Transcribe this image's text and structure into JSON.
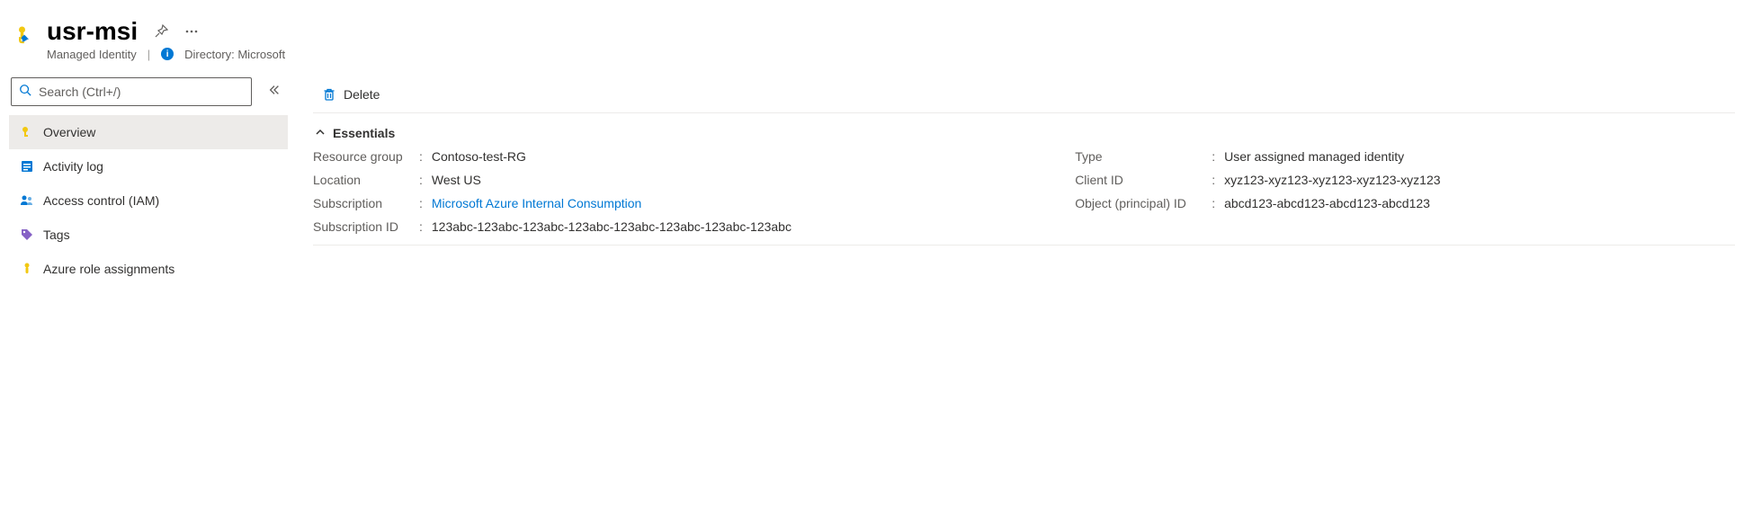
{
  "header": {
    "title": "usr-msi",
    "subtitle_type": "Managed Identity",
    "directory_label": "Directory: Microsoft"
  },
  "search": {
    "placeholder": "Search (Ctrl+/)"
  },
  "nav": {
    "items": [
      {
        "label": "Overview"
      },
      {
        "label": "Activity log"
      },
      {
        "label": "Access control (IAM)"
      },
      {
        "label": "Tags"
      },
      {
        "label": "Azure role assignments"
      }
    ]
  },
  "toolbar": {
    "delete_label": "Delete"
  },
  "essentials": {
    "title": "Essentials",
    "left": {
      "resource_group_label": "Resource group",
      "resource_group_value": "Contoso-test-RG",
      "location_label": "Location",
      "location_value": "West US",
      "subscription_label": "Subscription",
      "subscription_value": "Microsoft Azure Internal Consumption",
      "subscription_id_label": "Subscription ID",
      "subscription_id_value": "123abc-123abc-123abc-123abc-123abc-123abc-123abc-123abc"
    },
    "right": {
      "type_label": "Type",
      "type_value": "User assigned managed identity",
      "client_id_label": "Client ID",
      "client_id_value": "xyz123-xyz123-xyz123-xyz123-xyz123",
      "object_id_label": "Object (principal) ID",
      "object_id_value": "abcd123-abcd123-abcd123-abcd123"
    }
  }
}
